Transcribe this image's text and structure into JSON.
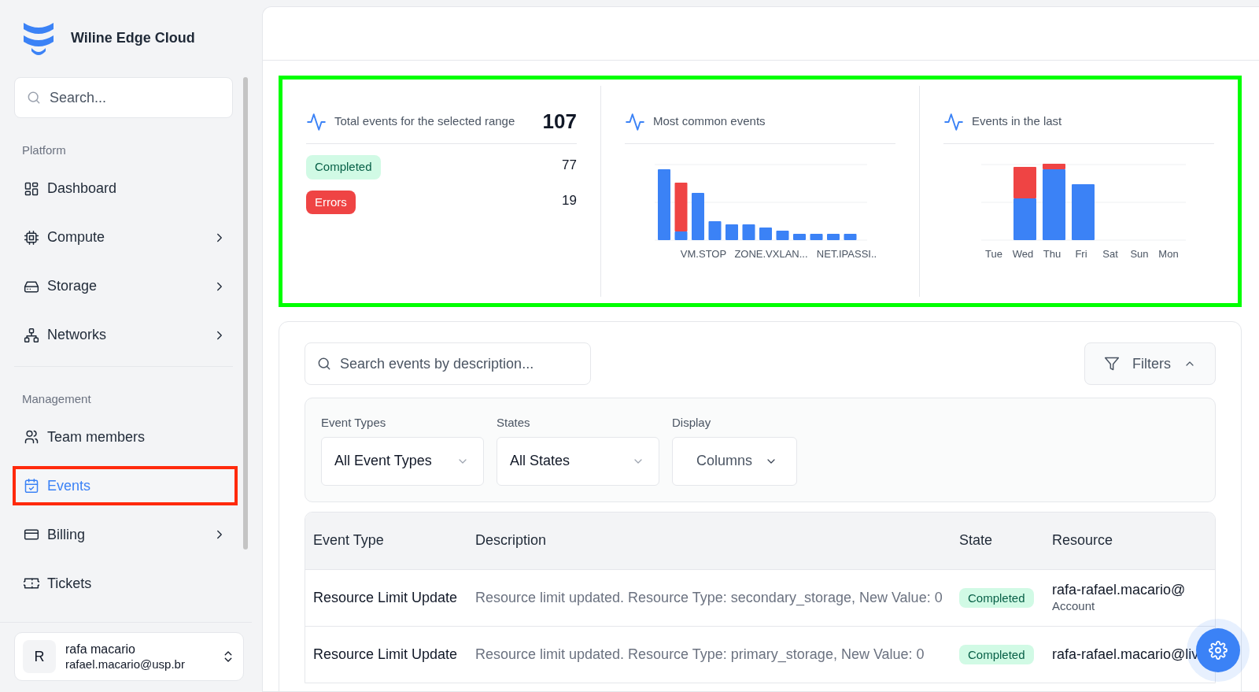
{
  "app": {
    "title": "Wiline Edge Cloud"
  },
  "sidebar": {
    "search": {
      "placeholder": "Search..."
    },
    "sections": [
      {
        "title": "Platform",
        "items": [
          {
            "label": "Dashboard",
            "has_submenu": false,
            "selected": false,
            "highlighted": false
          },
          {
            "label": "Compute",
            "has_submenu": true,
            "selected": false,
            "highlighted": false
          },
          {
            "label": "Storage",
            "has_submenu": true,
            "selected": false,
            "highlighted": false
          },
          {
            "label": "Networks",
            "has_submenu": true,
            "selected": false,
            "highlighted": false
          }
        ]
      },
      {
        "title": "Management",
        "items": [
          {
            "label": "Team members",
            "has_submenu": false,
            "selected": false,
            "highlighted": false
          },
          {
            "label": "Events",
            "has_submenu": false,
            "selected": true,
            "highlighted": true
          },
          {
            "label": "Billing",
            "has_submenu": true,
            "selected": false,
            "highlighted": false
          },
          {
            "label": "Tickets",
            "has_submenu": false,
            "selected": false,
            "highlighted": false
          }
        ]
      }
    ],
    "user": {
      "initial": "R",
      "name": "rafa macario",
      "email": "rafael.macario@usp.br"
    }
  },
  "stats": {
    "highlighted": true,
    "total": {
      "label": "Total events for the selected range",
      "value": "107",
      "breakdown": [
        {
          "label": "Completed",
          "kind": "success",
          "value": "77"
        },
        {
          "label": "Errors",
          "kind": "danger",
          "value": "19"
        }
      ]
    },
    "common": {
      "title": "Most common events",
      "x_labels": [
        "VM.STOP",
        "ZONE.VXLAN...",
        "NET.IPASSI.."
      ]
    },
    "weekly": {
      "title": "Events in the last",
      "days": [
        "Tue",
        "Wed",
        "Thu",
        "Fri",
        "Sat",
        "Sun",
        "Mon"
      ]
    }
  },
  "events": {
    "search": {
      "placeholder": "Search events by description..."
    },
    "filters_button": {
      "label": "Filters",
      "expanded": true
    },
    "filters": [
      {
        "label": "Event Types",
        "value": "All Event Types",
        "kind": "select"
      },
      {
        "label": "States",
        "value": "All States",
        "kind": "select"
      },
      {
        "label": "Display",
        "value": "Columns",
        "kind": "menu"
      }
    ],
    "table": {
      "columns": [
        "Event Type",
        "Description",
        "State",
        "Resource"
      ],
      "rows": [
        {
          "event_type": "Resource Limit Update",
          "description": "Resource limit updated. Resource Type: secondary_storage, New Value: 0",
          "state": "Completed",
          "resource": "rafa-rafael.macario@",
          "resource_type": "Account"
        },
        {
          "event_type": "Resource Limit Update",
          "description": "Resource limit updated. Resource Type: primary_storage, New Value: 0",
          "state": "Completed",
          "resource": "rafa-rafael.macario@liv"
        }
      ]
    }
  }
}
